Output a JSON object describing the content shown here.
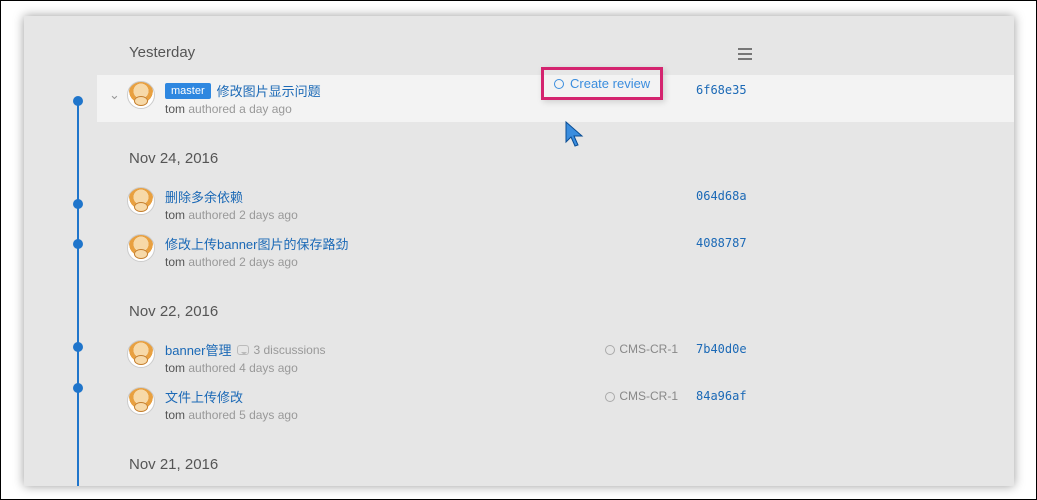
{
  "groups": [
    {
      "label": "Yesterday"
    },
    {
      "label": "Nov 24, 2016"
    },
    {
      "label": "Nov 22, 2016"
    },
    {
      "label": "Nov 21, 2016"
    }
  ],
  "commits": {
    "c1": {
      "branch": "master",
      "title": "修改图片显示问题",
      "author": "tom",
      "authored": "authored a day ago",
      "hash": "6f68e35",
      "create_review": "Create review"
    },
    "c2": {
      "title": "删除多余依赖",
      "author": "tom",
      "authored": "authored 2 days ago",
      "hash": "064d68a"
    },
    "c3": {
      "title": "修改上传banner图片的保存路劲",
      "author": "tom",
      "authored": "authored 2 days ago",
      "hash": "4088787"
    },
    "c4": {
      "title": "banner管理",
      "discussions": "3 discussions",
      "author": "tom",
      "authored": "authored 4 days ago",
      "review": "CMS-CR-1",
      "hash": "7b40d0e"
    },
    "c5": {
      "title": "文件上传修改",
      "author": "tom",
      "authored": "authored 5 days ago",
      "review": "CMS-CR-1",
      "hash": "84a96af"
    }
  }
}
